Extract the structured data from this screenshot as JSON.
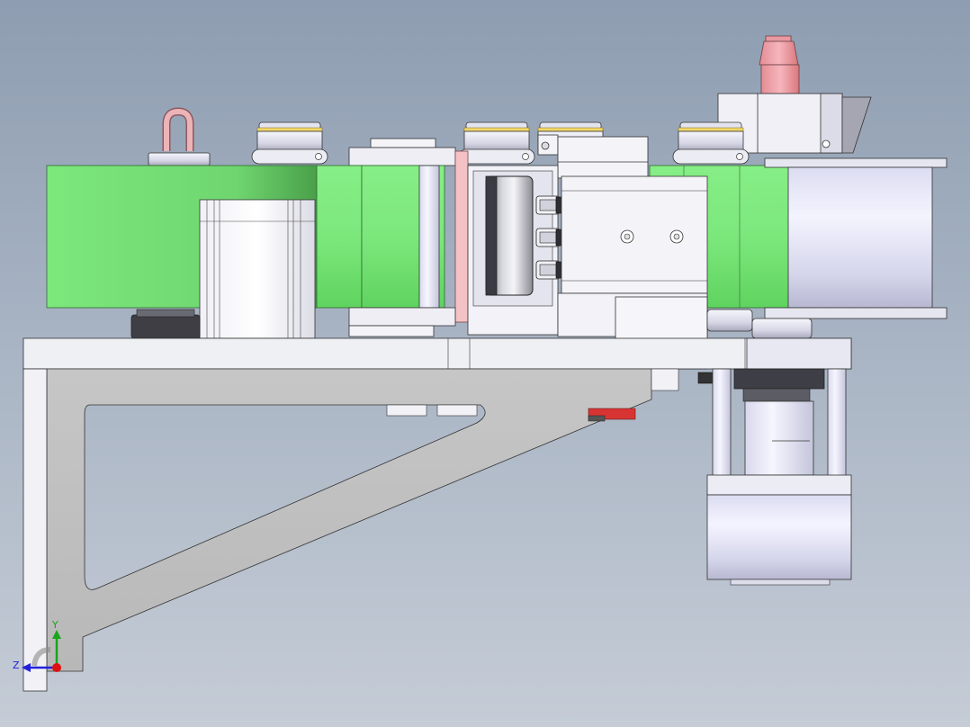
{
  "view": {
    "background_top": "#8e9db1",
    "background_bottom": "#c5ccd6",
    "belt_color": "#7ce87c",
    "belt_shade": "#5ccc5c",
    "part_light": "#f2f4f8",
    "part_shade": "#d4d7e3",
    "bracket_gray": "#c2c2c2",
    "eye_bolt": "#e0a0a0",
    "nozzle": "#f0a8ad",
    "accent_red": "#d83434"
  },
  "triad": {
    "y_label": "Y",
    "z_label": "Z",
    "y_color": "#1aa51a",
    "z_color": "#2222dd",
    "x_color": "#dd1111"
  }
}
